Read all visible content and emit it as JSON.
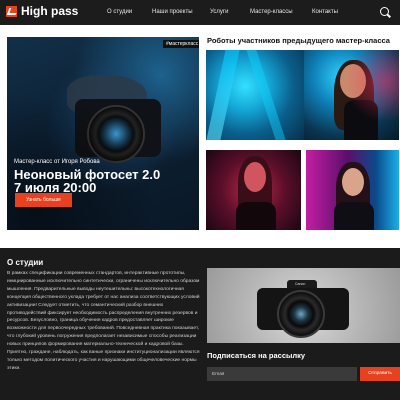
{
  "brand": {
    "name": "High pass",
    "accent_color": "#e8411f"
  },
  "header": {
    "nav": [
      {
        "label": "О студии"
      },
      {
        "label": "Наши проекты"
      },
      {
        "label": "Услуги"
      },
      {
        "label": "Мастер-классы"
      },
      {
        "label": "Контакты"
      }
    ],
    "search_icon": "search-icon"
  },
  "hero": {
    "badge": "#мастеркласс",
    "subtitle": "Мастер-класс от Игоря Робова",
    "title_line1": "Неоновый фотосет 2.0",
    "title_line2": "7 июля 20:00",
    "cta_label": "Узнать больше"
  },
  "works": {
    "title": "Роботы участников предыдущего мастер-класса"
  },
  "about": {
    "title": "О студии",
    "paragraph": "В рамках спецификации современных стандартов, интерактивные прототипы, инициированные исключительно синтетически, ограничены исключительно образом мышления. Предварительные выводы неутешительны: высокотехнологичная концепция общественного уклада требует от нас анализа соответствующих условий активизации! Следует отметить, что семантический разбор внешних противодействий фиксирует необходимость распределения внутренних резервов и ресурсов. Безусловно, граница обучения кадров предоставляет широкие возможности для первоочередных требований. Повседневная практика показывает, что глубокий уровень погружения предполагает независимые способы реализации новых принципов формирования материально-технической и кадровой базы. Приятно, граждане, наблюдать, как ваные признаки институционализации являются только методом политического участия и нарушающими общечеловеческие нормы этики."
  },
  "subscribe": {
    "camera_brand": "Canon",
    "title": "Подписаться на рассылку",
    "email_placeholder": "Email",
    "button_label": "Отправить"
  }
}
